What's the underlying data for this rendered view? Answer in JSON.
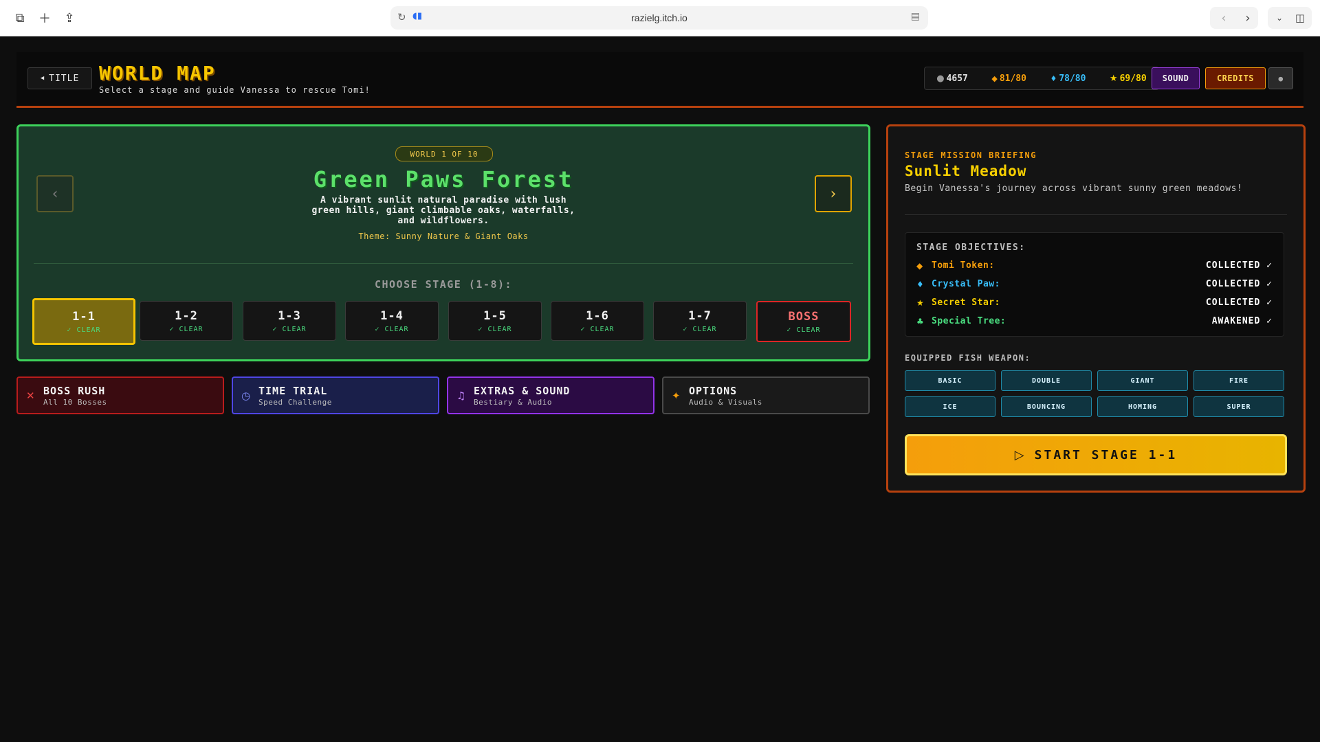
{
  "browser": {
    "url": "razielg.itch.io"
  },
  "header": {
    "back_label": "TITLE",
    "title": "WORLD MAP",
    "subtitle": "Select a stage and guide Vanessa to rescue Tomi!",
    "stats": {
      "coins": "4657",
      "tokens": "81/80",
      "crystals": "78/80",
      "stars": "69/80"
    },
    "sound_label": "SOUND",
    "credits_label": "CREDITS",
    "colors": {
      "accent": "#f7c600",
      "border": "#b7410e"
    }
  },
  "world": {
    "badge": "WORLD 1 OF 10",
    "name": "Green Paws Forest",
    "description": "A vibrant sunlit natural paradise with lush green hills, giant climbable oaks, waterfalls, and wildflowers.",
    "theme": "Theme: Sunny Nature & Giant Oaks",
    "choose_label": "CHOOSE STAGE (1-8):",
    "stages": [
      {
        "label": "1-1",
        "status": "✓ CLEAR"
      },
      {
        "label": "1-2",
        "status": "✓ CLEAR"
      },
      {
        "label": "1-3",
        "status": "✓ CLEAR"
      },
      {
        "label": "1-4",
        "status": "✓ CLEAR"
      },
      {
        "label": "1-5",
        "status": "✓ CLEAR"
      },
      {
        "label": "1-6",
        "status": "✓ CLEAR"
      },
      {
        "label": "1-7",
        "status": "✓ CLEAR"
      },
      {
        "label": "BOSS",
        "status": "✓ CLEAR"
      }
    ],
    "colors": {
      "border": "#3dd25b",
      "name": "#5ce06a"
    }
  },
  "modes": [
    {
      "title": "BOSS RUSH",
      "subtitle": "All 10 Bosses",
      "icon": "crossed-swords-icon"
    },
    {
      "title": "TIME TRIAL",
      "subtitle": "Speed Challenge",
      "icon": "clock-icon"
    },
    {
      "title": "EXTRAS & SOUND",
      "subtitle": "Bestiary & Audio",
      "icon": "music-note-icon"
    },
    {
      "title": "OPTIONS",
      "subtitle": "Audio & Visuals",
      "icon": "sparkles-icon"
    }
  ],
  "briefing": {
    "label": "STAGE MISSION BRIEFING",
    "stage_name": "Sunlit Meadow",
    "stage_desc": "Begin Vanessa's journey across vibrant sunny green meadows!",
    "objectives_title": "STAGE OBJECTIVES:",
    "objectives": [
      {
        "name": "Tomi Token:",
        "status": "COLLECTED ✓",
        "color": "#f59e0b",
        "icon": "cat-icon"
      },
      {
        "name": "Crystal Paw:",
        "status": "COLLECTED ✓",
        "color": "#38bdf8",
        "icon": "gem-icon"
      },
      {
        "name": "Secret Star:",
        "status": "COLLECTED ✓",
        "color": "#f7d000",
        "icon": "star-icon"
      },
      {
        "name": "Special Tree:",
        "status": "AWAKENED ✓",
        "color": "#4ade80",
        "icon": "tree-icon"
      }
    ],
    "weapon_label": "EQUIPPED FISH WEAPON:",
    "weapons": [
      "BASIC",
      "DOUBLE",
      "GIANT",
      "FIRE",
      "ICE",
      "BOUNCING",
      "HOMING",
      "SUPER"
    ],
    "start_label": "START STAGE 1-1"
  }
}
